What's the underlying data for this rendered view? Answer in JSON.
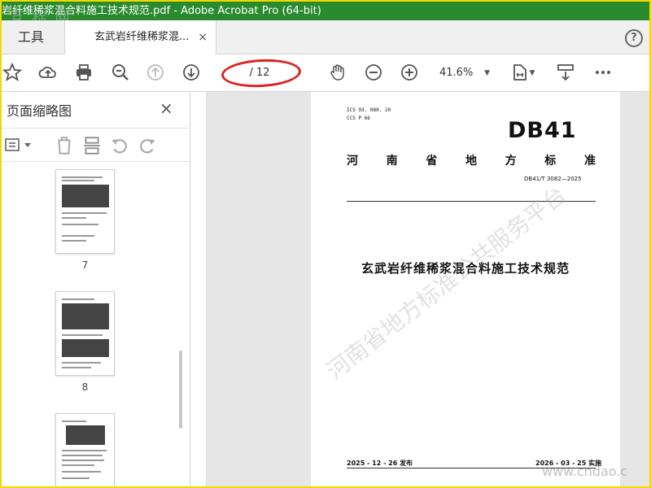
{
  "window": {
    "title": "岩纤维稀浆混合料施工技术规范.pdf - Adobe Acrobat Pro (64-bit)",
    "watermark_top": "互 标 网"
  },
  "tabs": {
    "tools_label": "工具",
    "doc_label": "玄武岩纤维稀浆混...",
    "close_glyph": "×",
    "help_glyph": "?"
  },
  "toolbar": {
    "page_indicator": "/ 12",
    "zoom_value": "41.6%",
    "icons": [
      "star-icon",
      "cloud-upload-icon",
      "print-icon",
      "zoom-search-icon",
      "page-up-icon",
      "page-down-icon",
      "hand-icon",
      "zoom-out-icon",
      "zoom-in-icon",
      "fit-page-icon",
      "scroll-mode-icon",
      "more-icon"
    ]
  },
  "sidebar": {
    "title": "页面缩略图",
    "close_glyph": "×",
    "thumbnails": [
      {
        "label": "7"
      },
      {
        "label": "8"
      },
      {
        "label": ""
      }
    ]
  },
  "document": {
    "ics": "ICS  93. 080. 20",
    "ccs": "CCS  P  66",
    "db_code": "DB41",
    "standard_name_chars": [
      "河",
      "南",
      "省",
      "地",
      "方",
      "标",
      "准"
    ],
    "standard_number": "DB41/T 3082—2025",
    "title": "玄武岩纤维稀浆混合料施工技术规范",
    "publish_date": "2025 - 12 - 26 发布",
    "implement_date": "2026 - 03 - 25 实施",
    "watermark_diag": "河南省地方标准公共服务平台",
    "watermark_bottom": "www.cndao.c"
  },
  "colors": {
    "titlebar": "#2a8a2e",
    "frame_border": "#f5d800",
    "annotation_oval": "#e02020",
    "cursor": "#1e6fd9"
  }
}
